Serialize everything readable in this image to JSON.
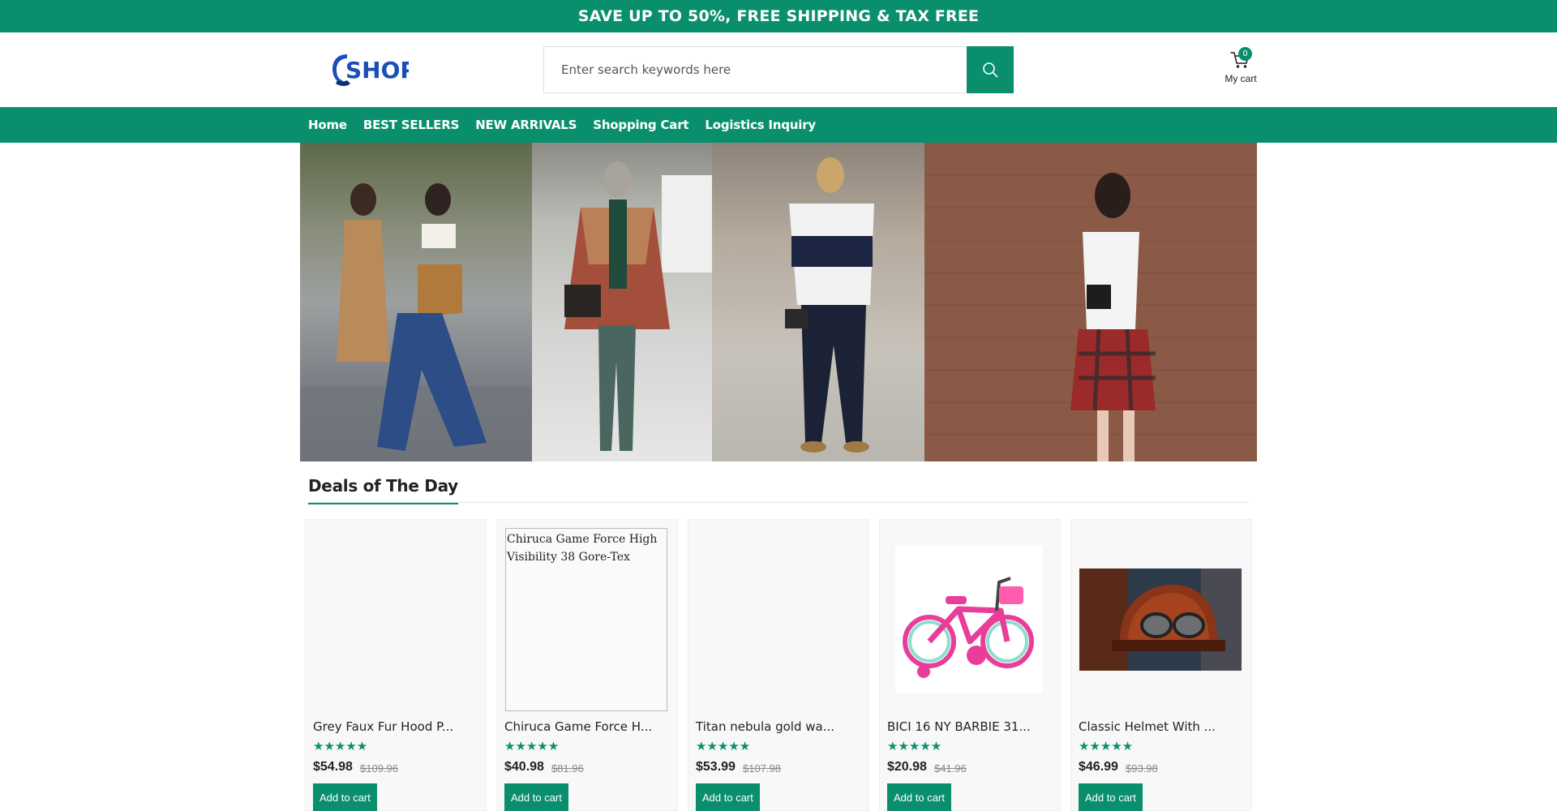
{
  "promo": {
    "text": "SAVE UP TO 50%, FREE SHIPPING & TAX FREE"
  },
  "header": {
    "logo_text": "SHOP",
    "search": {
      "placeholder": "Enter search keywords here",
      "value": ""
    },
    "cart": {
      "count": "0",
      "label": "My cart"
    }
  },
  "nav": {
    "items": [
      {
        "label": "Home"
      },
      {
        "label": "BEST SELLERS"
      },
      {
        "label": "NEW ARRIVALS"
      },
      {
        "label": "Shopping Cart"
      },
      {
        "label": "Logistics Inquiry"
      }
    ]
  },
  "deals": {
    "title": "Deals of The Day",
    "products": [
      {
        "name": "Grey Faux Fur Hood P...",
        "stars": "★★★★★",
        "price": "$54.98",
        "old_price": "$109.96",
        "button": "Add to cart"
      },
      {
        "name": "Chiruca Game Force H...",
        "image_alt": "Chiruca Game Force High Visibility 38 Gore-Tex",
        "stars": "★★★★★",
        "price": "$40.98",
        "old_price": "$81.96",
        "button": "Add to cart"
      },
      {
        "name": "Titan nebula gold wa...",
        "stars": "★★★★★",
        "price": "$53.99",
        "old_price": "$107.98",
        "button": "Add to cart"
      },
      {
        "name": "BICI 16 NY BARBIE 31...",
        "stars": "★★★★★",
        "price": "$20.98",
        "old_price": "$41.96",
        "button": "Add to cart"
      },
      {
        "name": "Classic Helmet With ...",
        "stars": "★★★★★",
        "price": "$46.99",
        "old_price": "$93.98",
        "button": "Add to cart"
      }
    ]
  },
  "colors": {
    "accent": "#0a8f6e"
  }
}
